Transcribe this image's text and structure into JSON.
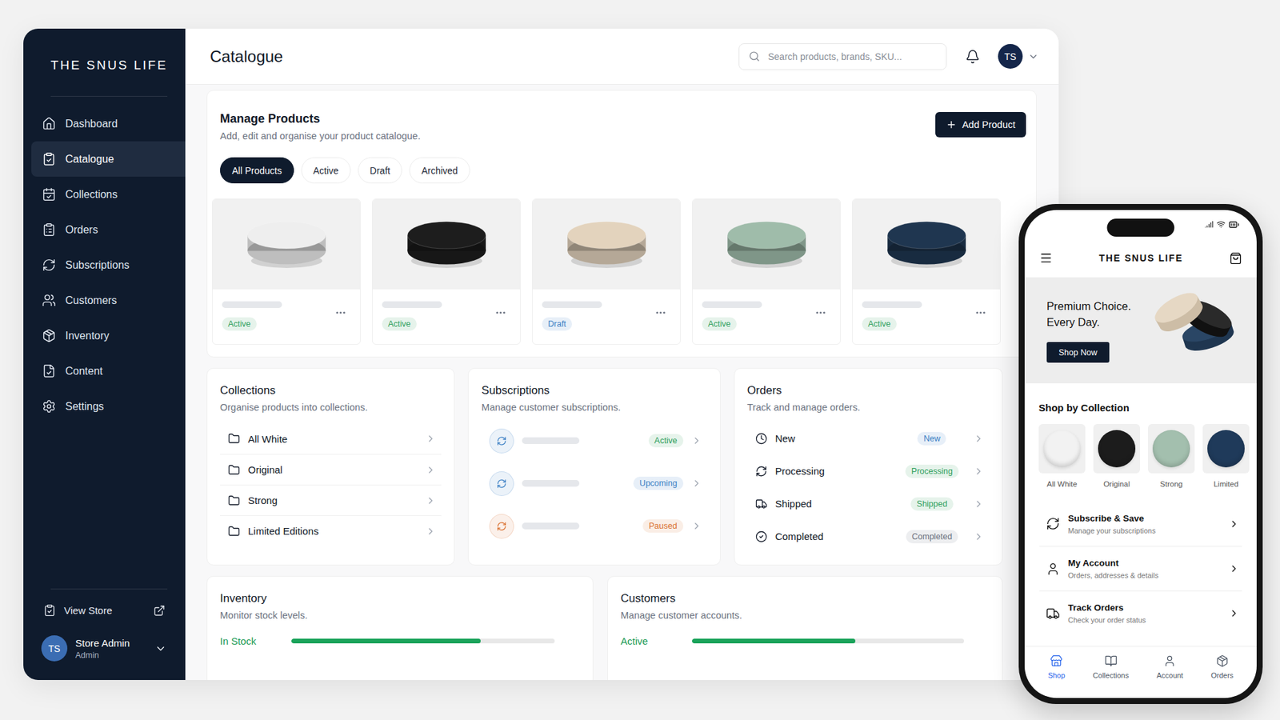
{
  "sidebar": {
    "brand": "THE SNUS LIFE",
    "items": [
      {
        "label": "Dashboard",
        "selected": false
      },
      {
        "label": "Catalogue",
        "selected": true
      },
      {
        "label": "Collections",
        "selected": false
      },
      {
        "label": "Orders",
        "selected": false
      },
      {
        "label": "Subscriptions",
        "selected": false
      },
      {
        "label": "Customers",
        "selected": false
      },
      {
        "label": "Inventory",
        "selected": false
      },
      {
        "label": "Content",
        "selected": false
      },
      {
        "label": "Settings",
        "selected": false
      }
    ],
    "view_store": "View Store",
    "user": {
      "initials": "TS",
      "name": "Store Admin",
      "role": "Admin"
    }
  },
  "header": {
    "title": "Catalogue",
    "search_placeholder": "Search products, brands, SKU...",
    "avatar": "TS"
  },
  "manage": {
    "title": "Manage Products",
    "description": "Add, edit and organise your product catalogue.",
    "add_button": "Add Product",
    "filters": [
      {
        "label": "All Products",
        "selected": true
      },
      {
        "label": "Active",
        "selected": false
      },
      {
        "label": "Draft",
        "selected": false
      },
      {
        "label": "Archived",
        "selected": false
      }
    ],
    "products": [
      {
        "color": "#eeeeee",
        "status": "Active",
        "status_color": "#2e9e5b"
      },
      {
        "color": "#1d1d1d",
        "status": "Active",
        "status_color": "#2e9e5b"
      },
      {
        "color": "#e3d3bd",
        "status": "Draft",
        "status_color": "#3b7fc4"
      },
      {
        "color": "#9fbcaa",
        "status": "Active",
        "status_color": "#2e9e5b"
      },
      {
        "color": "#1f3650",
        "status": "Active",
        "status_color": "#2e9e5b"
      }
    ]
  },
  "collections": {
    "title": "Collections",
    "description": "Organise products into collections.",
    "items": [
      "All White",
      "Original",
      "Strong",
      "Limited Editions"
    ]
  },
  "subscriptions": {
    "title": "Subscriptions",
    "description": "Manage customer subscriptions.",
    "rows": [
      {
        "status": "Active",
        "color": "#2e9e5b",
        "icon_color": "#3b7fc4"
      },
      {
        "status": "Upcoming",
        "color": "#3b7fc4",
        "icon_color": "#3b7fc4"
      },
      {
        "status": "Paused",
        "color": "#d9702f",
        "icon_color": "#d9702f"
      }
    ]
  },
  "orders": {
    "title": "Orders",
    "description": "Track and manage orders.",
    "rows": [
      {
        "label": "New",
        "status": "New",
        "color": "#3b7fc4"
      },
      {
        "label": "Processing",
        "status": "Processing",
        "color": "#2e9e5b"
      },
      {
        "label": "Shipped",
        "status": "Shipped",
        "color": "#2e9e5b"
      },
      {
        "label": "Completed",
        "status": "Completed",
        "color": "#6b7280"
      }
    ]
  },
  "inventory": {
    "title": "Inventory",
    "description": "Monitor stock levels.",
    "label": "In Stock",
    "level": 0.72
  },
  "customers": {
    "title": "Customers",
    "description": "Manage customer accounts.",
    "label": "Active",
    "level": 0.6
  },
  "phone": {
    "brand": "THE SNUS LIFE",
    "hero": {
      "lines": [
        "Premium Choice.",
        "Every Day."
      ],
      "button": "Shop Now"
    },
    "collections_title": "Shop by Collection",
    "collections": [
      {
        "label": "All White",
        "color": "#f2f2f2"
      },
      {
        "label": "Original",
        "color": "#1c1c1c"
      },
      {
        "label": "Strong",
        "color": "#a3bfae"
      },
      {
        "label": "Limited",
        "color": "#1f3a5a"
      }
    ],
    "menu": [
      {
        "title": "Subscribe & Save",
        "subtitle": "Manage your subscriptions"
      },
      {
        "title": "My Account",
        "subtitle": "Orders, addresses & details"
      },
      {
        "title": "Track Orders",
        "subtitle": "Check your order status"
      }
    ],
    "nav": [
      {
        "label": "Shop",
        "selected": true
      },
      {
        "label": "Collections",
        "selected": false
      },
      {
        "label": "Account",
        "selected": false
      },
      {
        "label": "Orders",
        "selected": false
      }
    ]
  }
}
